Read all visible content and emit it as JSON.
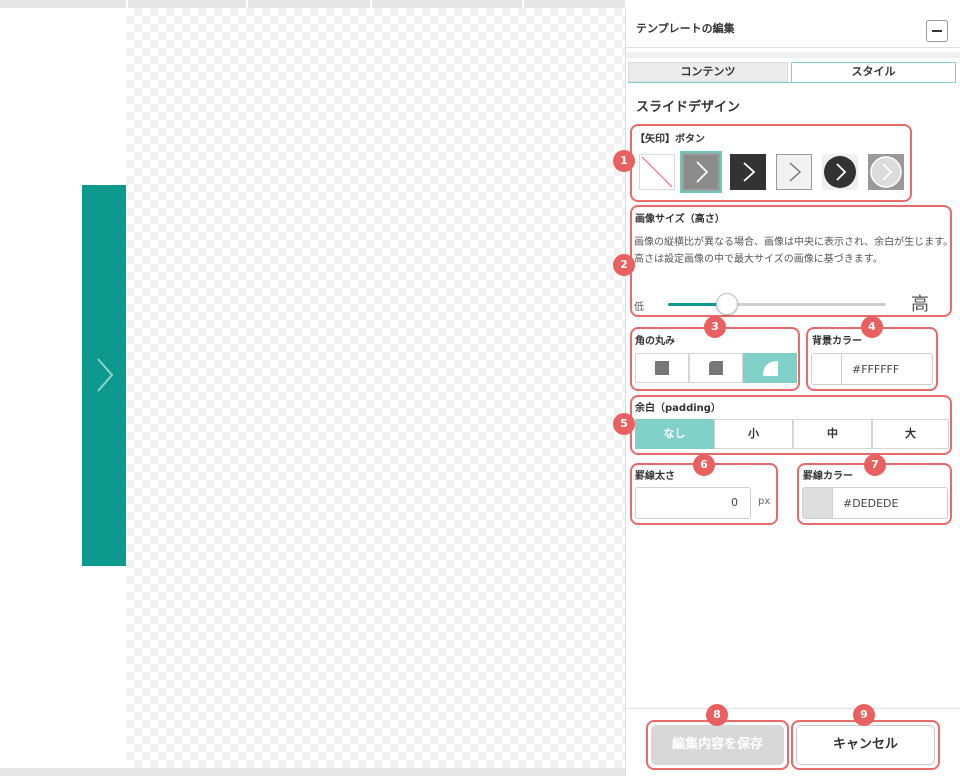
{
  "panel": {
    "title": "テンプレートの編集",
    "tabs": [
      {
        "label": "コンテンツ",
        "active": false
      },
      {
        "label": "スタイル",
        "active": true
      }
    ],
    "section_title": "スライドデザイン"
  },
  "arrow_button": {
    "label": "【矢印】ボタン",
    "options": [
      "none",
      "square-gray-filled",
      "square-dark",
      "square-outline",
      "circle-dark",
      "circle-light"
    ],
    "selected_index": 1
  },
  "image_size": {
    "label": "画像サイズ（高さ）",
    "description": "画像の縦横比が異なる場合、画像は中央に表示され、余白が生じます。高さは設定画像の中で最大サイズの画像に基づきます。",
    "low_label": "低",
    "high_label": "高",
    "value_fraction": 0.27
  },
  "corner": {
    "label": "角の丸み",
    "options": [
      "square",
      "rounded-small",
      "rounded-large"
    ],
    "selected_index": 2
  },
  "bg_color": {
    "label": "背景カラー",
    "value": "#FFFFFF",
    "swatch": "#FFFFFF"
  },
  "padding": {
    "label": "余白（padding）",
    "options": [
      "なし",
      "小",
      "中",
      "大"
    ],
    "selected_index": 0
  },
  "border_width": {
    "label": "罫線太さ",
    "value": "0",
    "unit": "px"
  },
  "border_color": {
    "label": "罫線カラー",
    "value": "#DEDEDE",
    "swatch": "#DEDEDE"
  },
  "footer": {
    "save_label": "編集内容を保存",
    "cancel_label": "キャンセル"
  },
  "badges": [
    "1",
    "2",
    "3",
    "4",
    "5",
    "6",
    "7",
    "8",
    "9"
  ],
  "colors": {
    "accent": "#0b9a8d",
    "active_segment": "#7fd1c7",
    "annotation": "#e86a6a"
  }
}
